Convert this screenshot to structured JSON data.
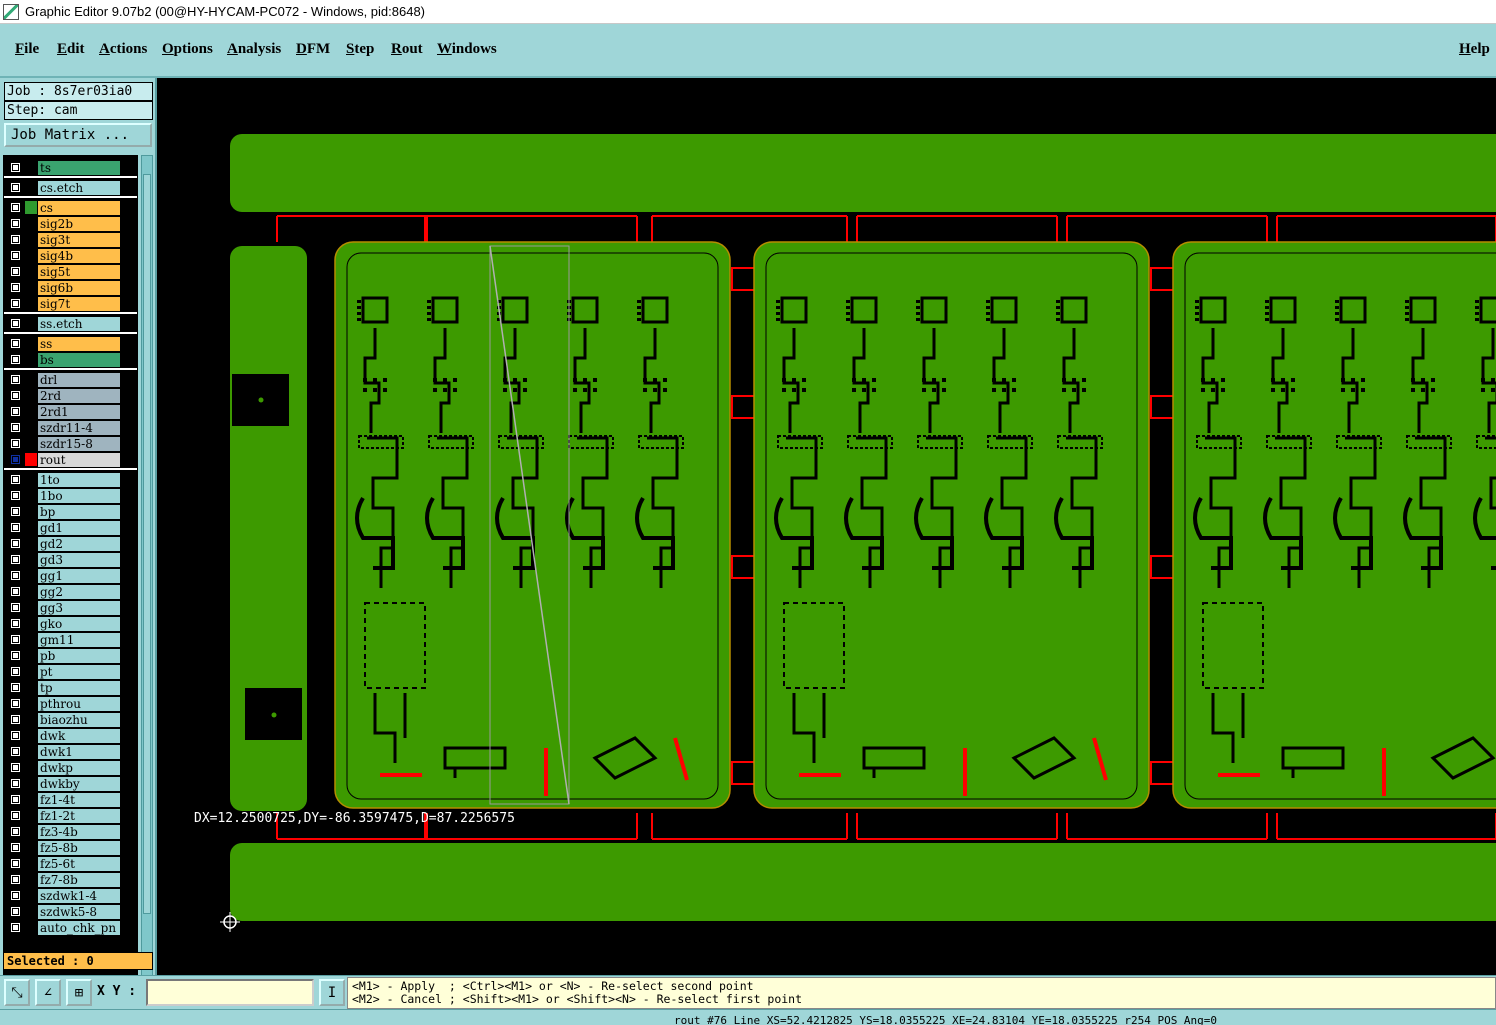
{
  "window": {
    "title": "Graphic Editor 9.07b2 (00@HY-HYCAM-PC072 - Windows, pid:8648)"
  },
  "menu": {
    "file": "File",
    "edit": "Edit",
    "actions": "Actions",
    "options": "Options",
    "analysis": "Analysis",
    "dfm": "DFM",
    "step": "Step",
    "rout": "Rout",
    "windows": "Windows",
    "help": "Help"
  },
  "panel": {
    "job": "Job : 8s7er03ia0",
    "step": "Step: cam",
    "job_matrix": "Job Matrix ...",
    "selected": "Selected : 0"
  },
  "layers": [
    {
      "name": "ts",
      "kind": "ts",
      "swatch": "#000000"
    },
    {
      "name": "cs.etch",
      "kind": "etch",
      "swatch": "#000000"
    },
    {
      "name": "cs",
      "kind": "sig",
      "swatch": "#2f9a2f"
    },
    {
      "name": "sig2b",
      "kind": "sig",
      "swatch": "#000000"
    },
    {
      "name": "sig3t",
      "kind": "sig",
      "swatch": "#000000"
    },
    {
      "name": "sig4b",
      "kind": "sig",
      "swatch": "#000000"
    },
    {
      "name": "sig5t",
      "kind": "sig",
      "swatch": "#000000"
    },
    {
      "name": "sig6b",
      "kind": "sig",
      "swatch": "#000000"
    },
    {
      "name": "sig7t",
      "kind": "sig",
      "swatch": "#000000"
    },
    {
      "name": "ss.etch",
      "kind": "etch",
      "swatch": "#000000"
    },
    {
      "name": "ss",
      "kind": "sig",
      "swatch": "#000000"
    },
    {
      "name": "bs",
      "kind": "ts",
      "swatch": "#000000"
    },
    {
      "name": "drl",
      "kind": "drl",
      "swatch": "#000000"
    },
    {
      "name": "2rd",
      "kind": "drl",
      "swatch": "#000000"
    },
    {
      "name": "2rd1",
      "kind": "drl",
      "swatch": "#000000"
    },
    {
      "name": "szdr11-4",
      "kind": "drl",
      "swatch": "#000000"
    },
    {
      "name": "szdr15-8",
      "kind": "drl",
      "swatch": "#000000"
    },
    {
      "name": "rout",
      "kind": "rout",
      "swatch": "#ff0000",
      "active": true
    },
    {
      "name": "1to",
      "kind": "misc",
      "swatch": "#000000"
    },
    {
      "name": "1bo",
      "kind": "misc",
      "swatch": "#000000"
    },
    {
      "name": "bp",
      "kind": "misc",
      "swatch": "#000000"
    },
    {
      "name": "gd1",
      "kind": "misc",
      "swatch": "#000000"
    },
    {
      "name": "gd2",
      "kind": "misc",
      "swatch": "#000000"
    },
    {
      "name": "gd3",
      "kind": "misc",
      "swatch": "#000000"
    },
    {
      "name": "gg1",
      "kind": "misc",
      "swatch": "#000000"
    },
    {
      "name": "gg2",
      "kind": "misc",
      "swatch": "#000000"
    },
    {
      "name": "gg3",
      "kind": "misc",
      "swatch": "#000000"
    },
    {
      "name": "gko",
      "kind": "misc",
      "swatch": "#000000"
    },
    {
      "name": "gm11",
      "kind": "misc",
      "swatch": "#000000"
    },
    {
      "name": "pb",
      "kind": "misc",
      "swatch": "#000000"
    },
    {
      "name": "pt",
      "kind": "misc",
      "swatch": "#000000"
    },
    {
      "name": "tp",
      "kind": "misc",
      "swatch": "#000000"
    },
    {
      "name": "pthrou",
      "kind": "misc",
      "swatch": "#000000"
    },
    {
      "name": "biaozhu",
      "kind": "misc",
      "swatch": "#000000"
    },
    {
      "name": "dwk",
      "kind": "misc",
      "swatch": "#000000"
    },
    {
      "name": "dwk1",
      "kind": "misc",
      "swatch": "#000000"
    },
    {
      "name": "dwkp",
      "kind": "misc",
      "swatch": "#000000"
    },
    {
      "name": "dwkby",
      "kind": "misc",
      "swatch": "#000000"
    },
    {
      "name": "fz1-4t",
      "kind": "misc",
      "swatch": "#000000"
    },
    {
      "name": "fz1-2t",
      "kind": "misc",
      "swatch": "#000000"
    },
    {
      "name": "fz3-4b",
      "kind": "misc",
      "swatch": "#000000"
    },
    {
      "name": "fz5-8b",
      "kind": "misc",
      "swatch": "#000000"
    },
    {
      "name": "fz5-6t",
      "kind": "misc",
      "swatch": "#000000"
    },
    {
      "name": "fz7-8b",
      "kind": "misc",
      "swatch": "#000000"
    },
    {
      "name": "szdwk1-4",
      "kind": "misc",
      "swatch": "#000000"
    },
    {
      "name": "szdwk5-8",
      "kind": "misc",
      "swatch": "#000000"
    },
    {
      "name": "auto_chk_pn",
      "kind": "misc",
      "swatch": "#000000"
    }
  ],
  "canvas": {
    "measure": "DX=12.2500725,DY=-86.3597475,D=87.2256575"
  },
  "bottom": {
    "xy_label": "X Y :",
    "xy_value": "",
    "prompt_line1": "<M1> - Apply  ; <Ctrl><M1> or <N> - Re-select second point",
    "prompt_line2": "<M2> - Cancel ; <Shift><M1> or <Shift><N> - Re-select first point"
  },
  "status": {
    "text": "rout #76 Line XS=52.4212825 YS=18.0355225 XE=24.83104 YE=18.0355225 r254 POS Ang=0"
  },
  "colors": {
    "background": "#9fd6d8",
    "board": "#3d9a00",
    "rout": "#ff0000",
    "canvas": "#000000"
  }
}
